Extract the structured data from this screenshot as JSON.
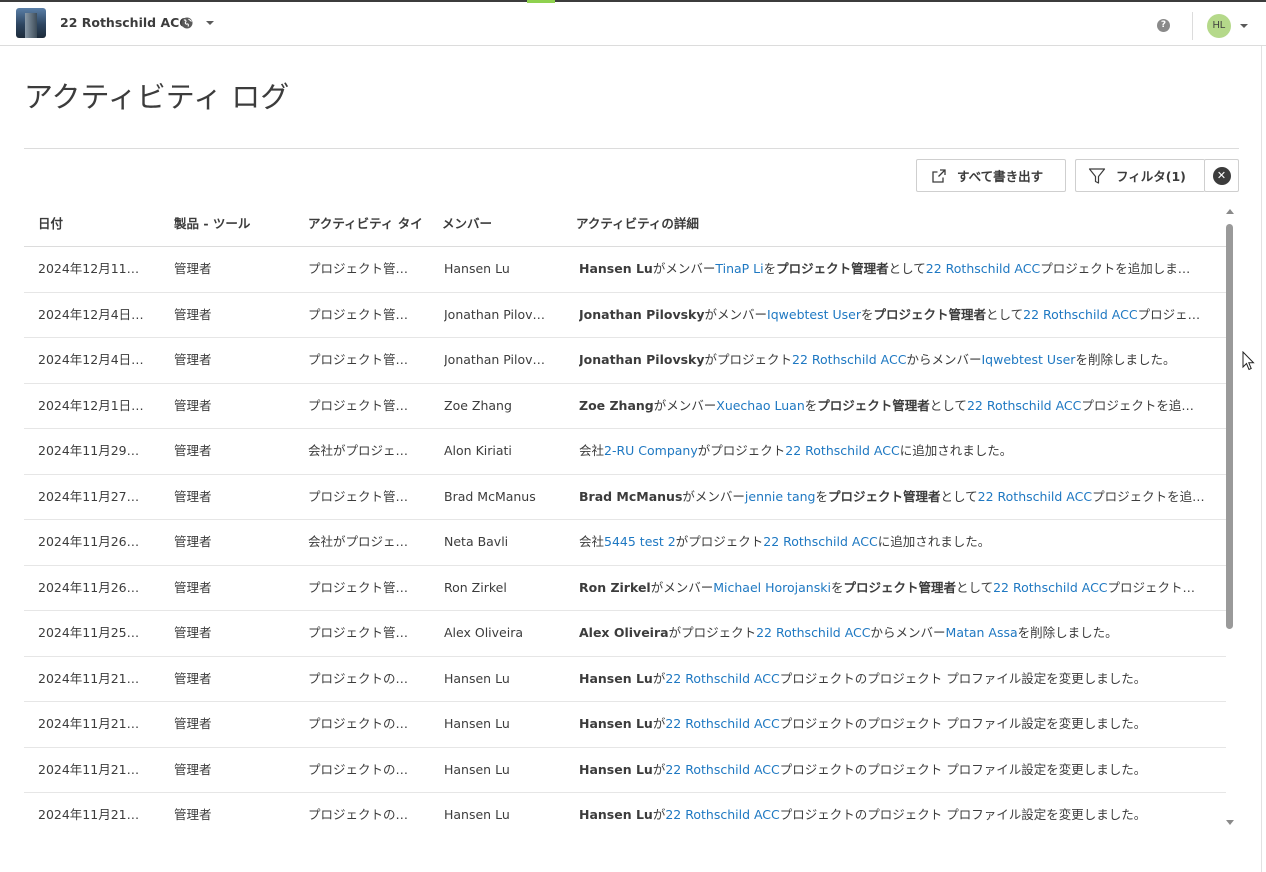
{
  "header": {
    "project_name": "22 Rothschild ACC",
    "avatar_initials": "HL",
    "help_glyph": "?"
  },
  "page": {
    "title": "アクティビティ ログ"
  },
  "toolbar": {
    "export_label": "すべて書き出す",
    "filter_label": "フィルタ(1)",
    "clear_glyph": "✕"
  },
  "table": {
    "columns": [
      "日付",
      "製品 - ツール",
      "アクティビティ タイ",
      "メンバー",
      "アクティビティの詳細"
    ],
    "rows": [
      {
        "date": "2024年12月11日…",
        "tool": "管理者",
        "type": "プロジェクト管…",
        "member": "Hansen Lu",
        "detail": [
          [
            "b",
            "Hansen Lu"
          ],
          [
            "t",
            "がメンバー"
          ],
          [
            "l",
            "TinaP Li"
          ],
          [
            "t",
            "を"
          ],
          [
            "b",
            "プロジェクト管理者"
          ],
          [
            "t",
            "として"
          ],
          [
            "l",
            "22 Rothschild ACC"
          ],
          [
            "t",
            "プロジェクトを追加しま…"
          ]
        ]
      },
      {
        "date": "2024年12月4日 …",
        "tool": "管理者",
        "type": "プロジェクト管…",
        "member": "Jonathan Pilov…",
        "detail": [
          [
            "b",
            "Jonathan Pilovsky"
          ],
          [
            "t",
            "がメンバー"
          ],
          [
            "l",
            "Iqwebtest User"
          ],
          [
            "t",
            "を"
          ],
          [
            "b",
            "プロジェクト管理者"
          ],
          [
            "t",
            "として"
          ],
          [
            "l",
            "22 Rothschild ACC"
          ],
          [
            "t",
            "プロジェ…"
          ]
        ]
      },
      {
        "date": "2024年12月4日 …",
        "tool": "管理者",
        "type": "プロジェクト管…",
        "member": "Jonathan Pilov…",
        "detail": [
          [
            "b",
            "Jonathan Pilovsky"
          ],
          [
            "t",
            "がプロジェクト"
          ],
          [
            "l",
            "22 Rothschild ACC"
          ],
          [
            "t",
            "からメンバー"
          ],
          [
            "l",
            "Iqwebtest User"
          ],
          [
            "t",
            "を削除しました。"
          ]
        ]
      },
      {
        "date": "2024年12月1日 …",
        "tool": "管理者",
        "type": "プロジェクト管…",
        "member": "Zoe Zhang",
        "detail": [
          [
            "b",
            "Zoe Zhang"
          ],
          [
            "t",
            "がメンバー"
          ],
          [
            "l",
            "Xuechao Luan"
          ],
          [
            "t",
            "を"
          ],
          [
            "b",
            "プロジェクト管理者"
          ],
          [
            "t",
            "として"
          ],
          [
            "l",
            "22 Rothschild ACC"
          ],
          [
            "t",
            "プロジェクトを追…"
          ]
        ]
      },
      {
        "date": "2024年11月29…",
        "tool": "管理者",
        "type": "会社がプロジェ…",
        "member": "Alon Kiriati",
        "detail": [
          [
            "t",
            "会社"
          ],
          [
            "l",
            "2-RU Company"
          ],
          [
            "t",
            "がプロジェクト"
          ],
          [
            "l",
            "22 Rothschild ACC"
          ],
          [
            "t",
            "に追加されました。"
          ]
        ]
      },
      {
        "date": "2024年11月27…",
        "tool": "管理者",
        "type": "プロジェクト管…",
        "member": "Brad McManus",
        "detail": [
          [
            "b",
            "Brad McManus"
          ],
          [
            "t",
            "がメンバー"
          ],
          [
            "l",
            "jennie tang"
          ],
          [
            "t",
            "を"
          ],
          [
            "b",
            "プロジェクト管理者"
          ],
          [
            "t",
            "として"
          ],
          [
            "l",
            "22 Rothschild ACC"
          ],
          [
            "t",
            "プロジェクトを追…"
          ]
        ]
      },
      {
        "date": "2024年11月26…",
        "tool": "管理者",
        "type": "会社がプロジェ…",
        "member": "Neta Bavli",
        "detail": [
          [
            "t",
            "会社"
          ],
          [
            "l",
            "5445 test 2"
          ],
          [
            "t",
            "がプロジェクト"
          ],
          [
            "l",
            "22 Rothschild ACC"
          ],
          [
            "t",
            "に追加されました。"
          ]
        ]
      },
      {
        "date": "2024年11月26…",
        "tool": "管理者",
        "type": "プロジェクト管…",
        "member": "Ron Zirkel",
        "detail": [
          [
            "b",
            "Ron Zirkel"
          ],
          [
            "t",
            "がメンバー"
          ],
          [
            "l",
            "Michael Horojanski"
          ],
          [
            "t",
            "を"
          ],
          [
            "b",
            "プロジェクト管理者"
          ],
          [
            "t",
            "として"
          ],
          [
            "l",
            "22 Rothschild ACC"
          ],
          [
            "t",
            "プロジェクト…"
          ]
        ]
      },
      {
        "date": "2024年11月25…",
        "tool": "管理者",
        "type": "プロジェクト管…",
        "member": "Alex Oliveira",
        "detail": [
          [
            "b",
            "Alex Oliveira"
          ],
          [
            "t",
            "がプロジェクト"
          ],
          [
            "l",
            "22 Rothschild ACC"
          ],
          [
            "t",
            "からメンバー"
          ],
          [
            "l",
            "Matan Assa"
          ],
          [
            "t",
            "を削除しました。"
          ]
        ]
      },
      {
        "date": "2024年11月21日…",
        "tool": "管理者",
        "type": "プロジェクトの…",
        "member": "Hansen Lu",
        "detail": [
          [
            "b",
            "Hansen Lu"
          ],
          [
            "t",
            "が"
          ],
          [
            "l",
            "22 Rothschild ACC"
          ],
          [
            "t",
            "プロジェクトのプロジェクト プロファイル設定を変更しました。"
          ]
        ]
      },
      {
        "date": "2024年11月21日…",
        "tool": "管理者",
        "type": "プロジェクトの…",
        "member": "Hansen Lu",
        "detail": [
          [
            "b",
            "Hansen Lu"
          ],
          [
            "t",
            "が"
          ],
          [
            "l",
            "22 Rothschild ACC"
          ],
          [
            "t",
            "プロジェクトのプロジェクト プロファイル設定を変更しました。"
          ]
        ]
      },
      {
        "date": "2024年11月21日…",
        "tool": "管理者",
        "type": "プロジェクトの…",
        "member": "Hansen Lu",
        "detail": [
          [
            "b",
            "Hansen Lu"
          ],
          [
            "t",
            "が"
          ],
          [
            "l",
            "22 Rothschild ACC"
          ],
          [
            "t",
            "プロジェクトのプロジェクト プロファイル設定を変更しました。"
          ]
        ]
      },
      {
        "date": "2024年11月21日…",
        "tool": "管理者",
        "type": "プロジェクトの…",
        "member": "Hansen Lu",
        "detail": [
          [
            "b",
            "Hansen Lu"
          ],
          [
            "t",
            "が"
          ],
          [
            "l",
            "22 Rothschild ACC"
          ],
          [
            "t",
            "プロジェクトのプロジェクト プロファイル設定を変更しました。"
          ]
        ]
      }
    ]
  },
  "colors": {
    "link": "#1e78c2",
    "text": "#3c3c3c",
    "avatar_bg": "#b5d98a"
  },
  "icons": {
    "project": "building-thumbnail-icon",
    "visibility": "globe-icon",
    "dropdown": "chevron-down-icon",
    "help": "help-icon",
    "export": "export-icon",
    "filter": "funnel-icon",
    "clear": "close-circle-icon"
  }
}
